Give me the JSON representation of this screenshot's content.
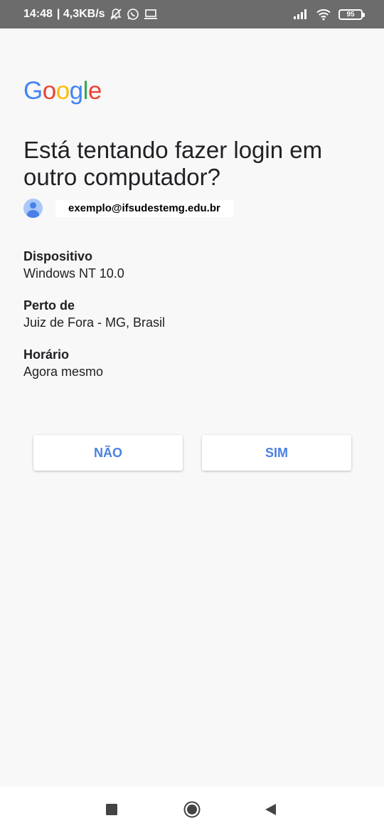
{
  "status_bar": {
    "time": "14:48",
    "speed": "| 4,3KB/s",
    "battery": "95",
    "icons": [
      "bell-muted-icon",
      "whatsapp-icon",
      "laptop-icon",
      "signal-icon",
      "wifi-icon",
      "battery-icon"
    ]
  },
  "logo": {
    "letters": [
      "G",
      "o",
      "o",
      "g",
      "l",
      "e"
    ],
    "colors": [
      "#4285F4",
      "#EA4335",
      "#FBBC05",
      "#4285F4",
      "#34A853",
      "#EA4335"
    ]
  },
  "headline": "Está tentando fazer login em outro computador?",
  "account": {
    "email": "exemplo@ifsudestemg.edu.br"
  },
  "details": [
    {
      "label": "Dispositivo",
      "value": "Windows NT 10.0"
    },
    {
      "label": "Perto de",
      "value": "Juiz de Fora - MG, Brasil"
    },
    {
      "label": "Horário",
      "value": "Agora mesmo"
    }
  ],
  "buttons": {
    "no": "NÃO",
    "yes": "SIM"
  },
  "accent_color": "#4A80E0",
  "nav": [
    "recents-icon",
    "home-icon",
    "back-icon"
  ]
}
